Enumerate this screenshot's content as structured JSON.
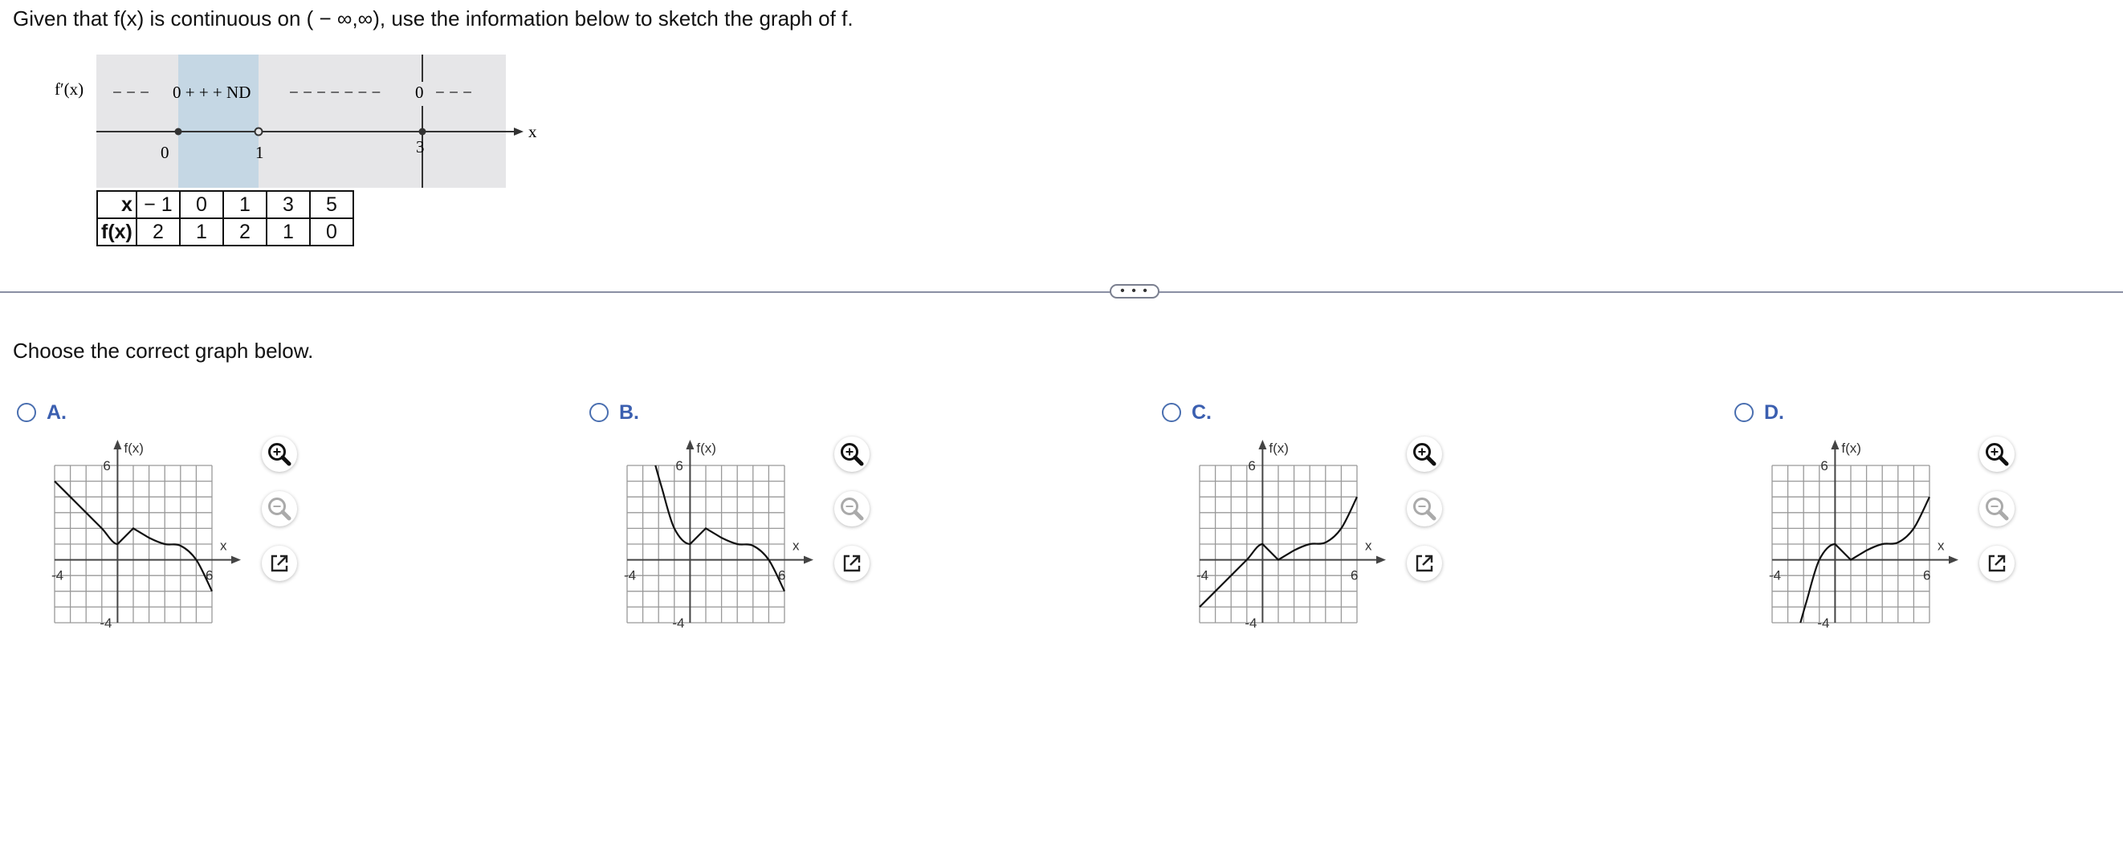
{
  "question": "Given that f(x) is continuous on ( − ∞,∞), use the information below to sketch the graph of f.",
  "sign_chart": {
    "label": "f′(x)",
    "axis_var": "x",
    "markers": [
      "0",
      "1",
      "3"
    ],
    "segments": [
      "− − −",
      "0 + + + ND",
      "− − − − − − −",
      "0",
      "− − −"
    ]
  },
  "table": {
    "x_header": "x",
    "fx_header": "f(x)",
    "x": [
      "− 1",
      "0",
      "1",
      "3",
      "5"
    ],
    "fx": [
      "2",
      "1",
      "2",
      "1",
      "0"
    ]
  },
  "more_label": "• • •",
  "prompt": "Choose the correct graph below.",
  "options": [
    {
      "letter": "A.",
      "selected": false
    },
    {
      "letter": "B.",
      "selected": false
    },
    {
      "letter": "C.",
      "selected": false
    },
    {
      "letter": "D.",
      "selected": false
    }
  ],
  "graph_labels": {
    "y": "f(x)",
    "x": "x",
    "xmin": "-4",
    "xmax": "6",
    "ymax": "6",
    "ymin": "-4"
  },
  "icons": {
    "zoom_in": "zoom-in-icon",
    "zoom_out": "zoom-out-icon",
    "open": "open-external-icon"
  },
  "colors": {
    "accent": "#3b5fb0",
    "shade": "#c5d7e4",
    "chart_bg": "#e6e6e8"
  },
  "chart_data": [
    {
      "type": "line",
      "option": "A",
      "xlim": [
        -4,
        6
      ],
      "ylim": [
        -4,
        6
      ],
      "grid": true,
      "x": [
        -4,
        -3,
        -2,
        -1,
        0,
        1,
        2,
        3,
        4,
        5,
        6
      ],
      "y": [
        5.0,
        4.0,
        3.0,
        2.0,
        1.0,
        2.0,
        1.4,
        1.0,
        0.9,
        0.0,
        -2.0
      ]
    },
    {
      "type": "line",
      "option": "B",
      "xlim": [
        -4,
        6
      ],
      "ylim": [
        -4,
        6
      ],
      "grid": true,
      "x": [
        -2.2,
        -1.8,
        -1.0,
        0,
        1,
        2,
        3,
        4,
        5,
        6
      ],
      "y": [
        6.0,
        4.6,
        2.0,
        1.0,
        2.0,
        1.4,
        1.0,
        0.9,
        0.0,
        -2.0
      ]
    },
    {
      "type": "line",
      "option": "C",
      "xlim": [
        -4,
        6
      ],
      "ylim": [
        -4,
        6
      ],
      "grid": true,
      "x": [
        -4,
        -3,
        -2,
        -1,
        0,
        1,
        2,
        3,
        4,
        5,
        6
      ],
      "y": [
        -3.0,
        -2.0,
        -1.0,
        0.0,
        1.0,
        0.0,
        0.6,
        1.0,
        1.1,
        2.0,
        4.0
      ]
    },
    {
      "type": "line",
      "option": "D",
      "xlim": [
        -4,
        6
      ],
      "ylim": [
        -4,
        6
      ],
      "grid": true,
      "x": [
        -2.2,
        -1.8,
        -1.0,
        0,
        1,
        2,
        3,
        4,
        5,
        6
      ],
      "y": [
        -4.0,
        -2.6,
        0.0,
        1.0,
        0.0,
        0.6,
        1.0,
        1.1,
        2.0,
        4.0
      ]
    }
  ]
}
